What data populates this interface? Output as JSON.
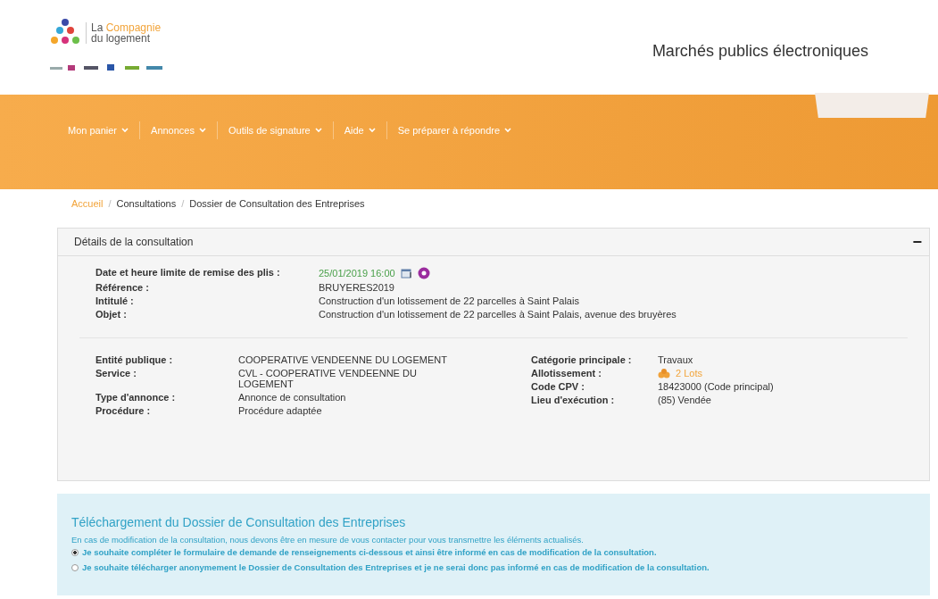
{
  "header": {
    "logo": {
      "line1_plain": "La",
      "line1_accent": "Compagnie",
      "line2": "du logement"
    },
    "site_title": "Marchés publics électroniques"
  },
  "nav": {
    "items": [
      {
        "label": "Mon panier"
      },
      {
        "label": "Annonces"
      },
      {
        "label": "Outils de signature"
      },
      {
        "label": "Aide"
      },
      {
        "label": "Se préparer à répondre"
      }
    ]
  },
  "breadcrumb": {
    "separator": "/",
    "items": [
      {
        "label": "Accueil",
        "kind": "link"
      },
      {
        "label": "Consultations",
        "kind": "text"
      },
      {
        "label": "Dossier de Consultation des Entreprises",
        "kind": "text"
      }
    ]
  },
  "details": {
    "title": "Détails de la consultation",
    "toggle": "−",
    "summary": [
      {
        "label": "Date et heure limite de remise des plis :",
        "value": "25/01/2019 16:00",
        "kind": "deadline"
      },
      {
        "label": "Référence :",
        "value": "BRUYERES2019",
        "kind": "plain"
      },
      {
        "label": "Intitulé :",
        "value": "Construction d'un lotissement de 22 parcelles à Saint Palais",
        "kind": "plain"
      },
      {
        "label": "Objet :",
        "value": "Construction d'un lotissement de 22 parcelles à Saint Palais, avenue des bruyères",
        "kind": "plain"
      }
    ],
    "left": [
      {
        "label": "Entité publique :",
        "value": "COOPERATIVE VENDEENNE DU LOGEMENT",
        "kind": "plain"
      },
      {
        "label": "Service :",
        "value": "CVL - COOPERATIVE VENDEENNE DU LOGEMENT",
        "kind": "plain"
      },
      {
        "label": "Type d'annonce :",
        "value": "Annonce de consultation",
        "kind": "plain"
      },
      {
        "label": "Procédure :",
        "value": "Procédure adaptée",
        "kind": "plain"
      }
    ],
    "right": [
      {
        "label": "Catégorie principale :",
        "value": "Travaux",
        "kind": "plain"
      },
      {
        "label": "Allotissement :",
        "value": "2 Lots",
        "kind": "lots"
      },
      {
        "label": "Code CPV :",
        "value": "18423000 (Code principal)",
        "kind": "plain"
      },
      {
        "label": "Lieu d'exécution :",
        "value": "(85) Vendée",
        "kind": "plain"
      }
    ]
  },
  "download": {
    "title": "Téléchargement du Dossier de Consultation des Entreprises",
    "intro": "En cas de modification de la consultation, nous devons être en mesure de vous contacter pour vous transmettre les éléments actualisés.",
    "options": [
      {
        "label": "Je souhaite compléter le formulaire de demande de renseignements ci-dessous et ainsi être informé en cas de modification de la consultation.",
        "selected": true
      },
      {
        "label": "Je souhaite télécharger anonymement le Dossier de Consultation des Entreprises et je ne serai donc pas informé en cas de modification de la consultation.",
        "selected": false
      }
    ]
  }
}
